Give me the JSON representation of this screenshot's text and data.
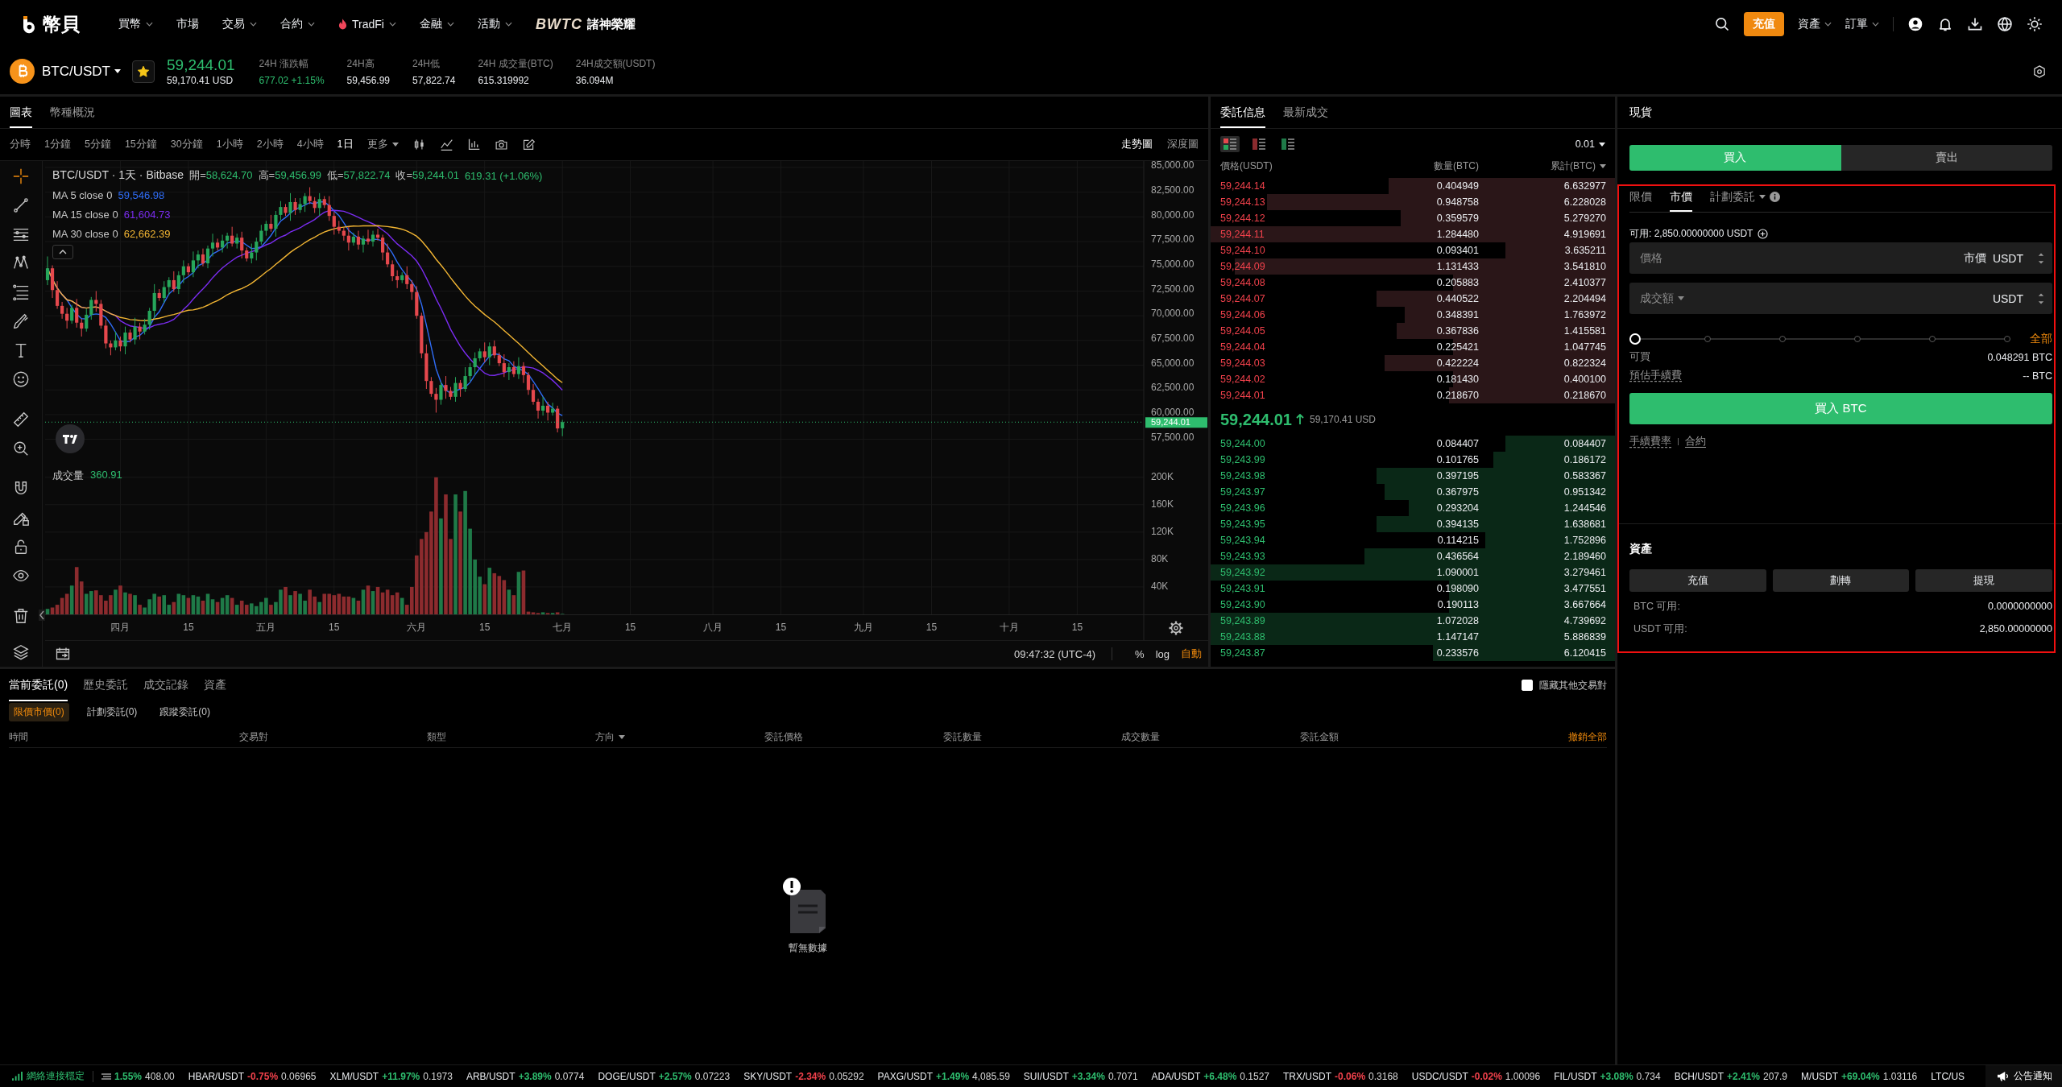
{
  "nav": {
    "logo": "幣貝",
    "menu": [
      {
        "label": "買幣",
        "dropdown": true,
        "kind": "plain"
      },
      {
        "label": "市場",
        "dropdown": false,
        "kind": "plain"
      },
      {
        "label": "交易",
        "dropdown": true,
        "kind": "plain"
      },
      {
        "label": "合約",
        "dropdown": true,
        "kind": "plain"
      },
      {
        "label": "TradFi",
        "dropdown": true,
        "kind": "hot"
      },
      {
        "label": "金融",
        "dropdown": true,
        "kind": "plain"
      },
      {
        "label": "活動",
        "dropdown": true,
        "kind": "plain"
      }
    ],
    "promo": {
      "brand": "BWTC",
      "title": "諸神榮耀"
    },
    "deposit_button": "充值",
    "right_menu": [
      {
        "label": "資產",
        "dropdown": true
      },
      {
        "label": "訂單",
        "dropdown": true
      }
    ]
  },
  "ticker": {
    "symbol": "BTC/USDT",
    "favorite": true,
    "last_price": "59,244.01",
    "usd_price": "59,170.41 USD",
    "stats": [
      {
        "label": "24H 漲跌幅",
        "value": "677.02 +1.15%",
        "color": "#2ebd6e"
      },
      {
        "label": "24H高",
        "value": "59,456.99",
        "color": "#eaecef"
      },
      {
        "label": "24H低",
        "value": "57,822.74",
        "color": "#eaecef"
      },
      {
        "label": "24H 成交量(BTC)",
        "value": "615.319992",
        "color": "#eaecef"
      },
      {
        "label": "24H成交額(USDT)",
        "value": "36.094M",
        "color": "#eaecef"
      }
    ]
  },
  "chart_panel": {
    "tabs": [
      {
        "label": "圖表",
        "selected": true
      },
      {
        "label": "幣種概況",
        "selected": false
      }
    ],
    "intervals": [
      {
        "label": "分時",
        "selected": false,
        "dropdown": false
      },
      {
        "label": "1分鐘",
        "selected": false,
        "dropdown": false
      },
      {
        "label": "5分鐘",
        "selected": false,
        "dropdown": false
      },
      {
        "label": "15分鐘",
        "selected": false,
        "dropdown": false
      },
      {
        "label": "30分鐘",
        "selected": false,
        "dropdown": false
      },
      {
        "label": "1小時",
        "selected": false,
        "dropdown": false
      },
      {
        "label": "2小時",
        "selected": false,
        "dropdown": false
      },
      {
        "label": "4小時",
        "selected": false,
        "dropdown": false
      },
      {
        "label": "1日",
        "selected": true,
        "dropdown": false
      },
      {
        "label": "更多",
        "selected": false,
        "dropdown": true
      }
    ],
    "views": [
      {
        "label": "走勢圖",
        "selected": true
      },
      {
        "label": "深度圖",
        "selected": false
      }
    ],
    "tool_groups": [
      [
        {
          "kind": "crosshair",
          "selected": true
        },
        {
          "kind": "trend-line",
          "selected": false
        },
        {
          "kind": "horizontal-lines",
          "selected": false
        },
        {
          "kind": "pattern",
          "selected": false
        },
        {
          "kind": "fib",
          "selected": false
        },
        {
          "kind": "brush",
          "selected": false
        },
        {
          "kind": "text",
          "selected": false
        },
        {
          "kind": "emoji",
          "selected": false
        }
      ],
      [
        {
          "kind": "ruler",
          "selected": false
        },
        {
          "kind": "zoom-in",
          "selected": false
        }
      ],
      [
        {
          "kind": "magnet",
          "selected": false
        },
        {
          "kind": "lock-drawing",
          "selected": false
        },
        {
          "kind": "lock",
          "selected": false
        },
        {
          "kind": "eye",
          "selected": false
        }
      ],
      [
        {
          "kind": "trash",
          "selected": false
        }
      ],
      [
        {
          "kind": "layers",
          "selected": false
        }
      ]
    ],
    "legend": {
      "title": "BTC/USDT · 1天 · Bitbase",
      "ohlc": [
        {
          "label": "開=",
          "value": "58,624.70"
        },
        {
          "label": "高=",
          "value": "59,456.99"
        },
        {
          "label": "低=",
          "value": "57,822.74"
        },
        {
          "label": "收=",
          "value": "59,244.01"
        }
      ],
      "change": "619.31 (+1.06%)"
    },
    "indicators": [
      {
        "name": "MA 5 close 0",
        "value": "59,546.98",
        "color": "#2f6cf5"
      },
      {
        "name": "MA 15 close 0",
        "value": "61,604.73",
        "color": "#7a2cf0"
      },
      {
        "name": "MA 30 close 0",
        "value": "62,662.39",
        "color": "#f2b533"
      }
    ],
    "price_axis": [
      "85,000.00",
      "82,500.00",
      "80,000.00",
      "77,500.00",
      "75,000.00",
      "72,500.00",
      "70,000.00",
      "67,500.00",
      "65,000.00",
      "62,500.00",
      "60,000.00",
      "57,500.00"
    ],
    "last_price": "59,244.01",
    "volume": {
      "label": "成交量",
      "value": "360.91"
    },
    "volume_axis": [
      "200K",
      "160K",
      "120K",
      "80K",
      "40K"
    ],
    "time_axis": [
      "四月",
      "15",
      "五月",
      "15",
      "六月",
      "15",
      "七月",
      "15",
      "八月",
      "15",
      "九月",
      "15",
      "十月",
      "15"
    ],
    "time": "09:47:32 (UTC-4)",
    "scale_options": [
      {
        "label": "%",
        "selected": false
      },
      {
        "label": "log",
        "selected": false
      },
      {
        "label": "自動",
        "selected": true
      }
    ]
  },
  "order_book": {
    "tabs": [
      {
        "label": "委託信息",
        "selected": true
      },
      {
        "label": "最新成交",
        "selected": false
      }
    ],
    "layouts": [
      {
        "kind": "both",
        "selected": true
      },
      {
        "kind": "asks",
        "selected": false
      },
      {
        "kind": "bids",
        "selected": false
      }
    ],
    "precision": "0.01",
    "columns": [
      {
        "label": "價格(USDT)",
        "dropdown": false
      },
      {
        "label": "數量(BTC)",
        "dropdown": false
      },
      {
        "label": "累計(BTC)",
        "dropdown": true
      }
    ],
    "asks": [
      {
        "price": "59,244.14",
        "amount": "0.404949",
        "total": "6.632977",
        "level": 0.56
      },
      {
        "price": "59,244.13",
        "amount": "0.948758",
        "total": "6.228028",
        "level": 0.86
      },
      {
        "price": "59,244.12",
        "amount": "0.359579",
        "total": "5.279270",
        "level": 0.53
      },
      {
        "price": "59,244.11",
        "amount": "1.284480",
        "total": "4.919691",
        "level": 1.0
      },
      {
        "price": "59,244.10",
        "amount": "0.093401",
        "total": "3.635211",
        "level": 0.27
      },
      {
        "price": "59,244.09",
        "amount": "1.131433",
        "total": "3.541810",
        "level": 0.94
      },
      {
        "price": "59,244.08",
        "amount": "0.205883",
        "total": "2.410377",
        "level": 0.4
      },
      {
        "price": "59,244.07",
        "amount": "0.440522",
        "total": "2.204494",
        "level": 0.59
      },
      {
        "price": "59,244.06",
        "amount": "0.348391",
        "total": "1.763972",
        "level": 0.52
      },
      {
        "price": "59,244.05",
        "amount": "0.367836",
        "total": "1.415581",
        "level": 0.54
      },
      {
        "price": "59,244.04",
        "amount": "0.225421",
        "total": "1.047745",
        "level": 0.4
      },
      {
        "price": "59,244.03",
        "amount": "0.422224",
        "total": "0.822324",
        "level": 0.57
      },
      {
        "price": "59,244.02",
        "amount": "0.181430",
        "total": "0.400100",
        "level": 0.4
      },
      {
        "price": "59,244.01",
        "amount": "0.218670",
        "total": "0.218670",
        "level": 0.41
      }
    ],
    "mid": {
      "price": "59,244.01",
      "usd": "59,170.41 USD",
      "rising": true
    },
    "bids": [
      {
        "price": "59,244.00",
        "amount": "0.084407",
        "total": "0.084407",
        "level": 0.27
      },
      {
        "price": "59,243.99",
        "amount": "0.101765",
        "total": "0.186172",
        "level": 0.3
      },
      {
        "price": "59,243.98",
        "amount": "0.397195",
        "total": "0.583367",
        "level": 0.59
      },
      {
        "price": "59,243.97",
        "amount": "0.367975",
        "total": "0.951342",
        "level": 0.57
      },
      {
        "price": "59,243.96",
        "amount": "0.293204",
        "total": "1.244546",
        "level": 0.51
      },
      {
        "price": "59,243.95",
        "amount": "0.394135",
        "total": "1.638681",
        "level": 0.59
      },
      {
        "price": "59,243.94",
        "amount": "0.114215",
        "total": "1.752896",
        "level": 0.32
      },
      {
        "price": "59,243.93",
        "amount": "0.436564",
        "total": "2.189460",
        "level": 0.62
      },
      {
        "price": "59,243.92",
        "amount": "1.090001",
        "total": "3.279461",
        "level": 1.0
      },
      {
        "price": "59,243.91",
        "amount": "0.198090",
        "total": "3.477551",
        "level": 0.41
      },
      {
        "price": "59,243.90",
        "amount": "0.190113",
        "total": "3.667664",
        "level": 0.41
      },
      {
        "price": "59,243.89",
        "amount": "1.072028",
        "total": "4.739692",
        "level": 1.0
      },
      {
        "price": "59,243.88",
        "amount": "1.147147",
        "total": "5.886839",
        "level": 1.0
      },
      {
        "price": "59,243.87",
        "amount": "0.233576",
        "total": "6.120415",
        "level": 0.45
      }
    ]
  },
  "spot_panel": {
    "title": "現貨",
    "sides": [
      {
        "label": "買入",
        "selected": true
      },
      {
        "label": "賣出",
        "selected": false
      }
    ],
    "order_types": [
      {
        "label": "限價",
        "selected": false,
        "dropdown": false,
        "info": false
      },
      {
        "label": "市價",
        "selected": true,
        "dropdown": false,
        "info": false
      },
      {
        "label": "計劃委託",
        "selected": false,
        "dropdown": true,
        "info": true
      }
    ],
    "available": "可用: 2,850.00000000 USDT",
    "price_field": {
      "label": "價格",
      "value": "市價",
      "unit": "USDT"
    },
    "amount_field": {
      "label": "成交額",
      "unit": "USDT"
    },
    "slider": {
      "level": 0,
      "max_label": "全部"
    },
    "info_rows": [
      {
        "label": "可買",
        "value": "0.048291 BTC",
        "underline": false
      },
      {
        "label": "預估手續費",
        "value": "-- BTC",
        "underline": true
      }
    ],
    "submit": "買入 BTC",
    "links": [
      {
        "label": "手續費率",
        "kind": "dotted"
      },
      {
        "label": "合約",
        "kind": "underlined"
      }
    ],
    "assets": {
      "title": "資產",
      "buttons": [
        "充值",
        "劃轉",
        "提現"
      ],
      "balances": [
        {
          "label": "BTC 可用:",
          "value": "0.0000000000"
        },
        {
          "label": "USDT 可用:",
          "value": "2,850.00000000"
        }
      ]
    }
  },
  "orders": {
    "tabs": [
      {
        "label": "當前委託(0)",
        "selected": true
      },
      {
        "label": "歷史委託",
        "selected": false
      },
      {
        "label": "成交記錄",
        "selected": false
      },
      {
        "label": "資產",
        "selected": false
      }
    ],
    "hide_other_pairs": {
      "label": "隱藏其他交易對",
      "checked": false
    },
    "sub_tabs": [
      {
        "label": "限價市價(0)",
        "selected": true
      },
      {
        "label": "計劃委託(0)",
        "selected": false
      },
      {
        "label": "跟蹤委託(0)",
        "selected": false
      }
    ],
    "columns": [
      {
        "label": "時間",
        "sort": false
      },
      {
        "label": "交易對",
        "sort": false
      },
      {
        "label": "類型",
        "sort": false
      },
      {
        "label": "方向",
        "sort": true
      },
      {
        "label": "委託價格",
        "sort": false
      },
      {
        "label": "委託數量",
        "sort": false
      },
      {
        "label": "成交數量",
        "sort": false
      },
      {
        "label": "委託金額",
        "sort": false
      }
    ],
    "cancel_all": "撤銷全部",
    "empty_text": "暫無數據"
  },
  "status_bar": {
    "connection": "網絡連接穩定",
    "tickers": [
      {
        "change": "1.55%",
        "price": "408.00",
        "color": "#2ebd6e"
      },
      {
        "pair": "HBAR/USDT",
        "change": "-0.75%",
        "price": "0.06965",
        "color": "#f0414b"
      },
      {
        "pair": "XLM/USDT",
        "change": "+11.97%",
        "price": "0.1973",
        "color": "#2ebd6e"
      },
      {
        "pair": "ARB/USDT",
        "change": "+3.89%",
        "price": "0.0774",
        "color": "#2ebd6e"
      },
      {
        "pair": "DOGE/USDT",
        "change": "+2.57%",
        "price": "0.07223",
        "color": "#2ebd6e"
      },
      {
        "pair": "SKY/USDT",
        "change": "-2.34%",
        "price": "0.05292",
        "color": "#f0414b"
      },
      {
        "pair": "PAXG/USDT",
        "change": "+1.49%",
        "price": "4,085.59",
        "color": "#2ebd6e"
      },
      {
        "pair": "SUI/USDT",
        "change": "+3.34%",
        "price": "0.7071",
        "color": "#2ebd6e"
      },
      {
        "pair": "ADA/USDT",
        "change": "+6.48%",
        "price": "0.1527",
        "color": "#2ebd6e"
      },
      {
        "pair": "TRX/USDT",
        "change": "-0.06%",
        "price": "0.3168",
        "color": "#f0414b"
      },
      {
        "pair": "USDC/USDT",
        "change": "-0.02%",
        "price": "1.00096",
        "color": "#f0414b"
      },
      {
        "pair": "FIL/USDT",
        "change": "+3.08%",
        "price": "0.734",
        "color": "#2ebd6e"
      },
      {
        "pair": "BCH/USDT",
        "change": "+2.41%",
        "price": "207.9",
        "color": "#2ebd6e"
      },
      {
        "pair": "M/USDT",
        "change": "+69.04%",
        "price": "1.03116",
        "color": "#2ebd6e"
      },
      {
        "pair": "LTC/US"
      }
    ],
    "announcements": "公告通知"
  }
}
